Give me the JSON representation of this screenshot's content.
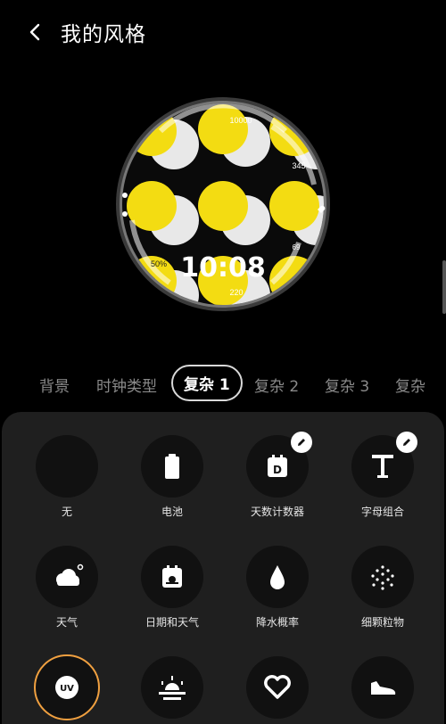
{
  "header": {
    "title": "我的风格",
    "back_icon": "back-arrow-icon"
  },
  "watch": {
    "time": "10:08",
    "steps_top": "10000",
    "steps_right": "345",
    "battery": "50%",
    "bottom_value": "220",
    "right_value": "69"
  },
  "tabs": [
    {
      "label": "背景"
    },
    {
      "label": "时钟类型"
    },
    {
      "label": "复杂 1"
    },
    {
      "label": "复杂 2"
    },
    {
      "label": "复杂 3"
    },
    {
      "label": "复杂"
    }
  ],
  "active_tab": "复杂 1",
  "grid": [
    {
      "label": "无",
      "icon": "empty-icon"
    },
    {
      "label": "电池",
      "icon": "battery-icon"
    },
    {
      "label": "天数计数器",
      "icon": "day-counter-icon",
      "editable": true
    },
    {
      "label": "字母组合",
      "icon": "monogram-icon",
      "editable": true
    },
    {
      "label": "天气",
      "icon": "weather-icon"
    },
    {
      "label": "日期和天气",
      "icon": "date-weather-icon"
    },
    {
      "label": "降水概率",
      "icon": "raindrop-icon"
    },
    {
      "label": "细颗粒物",
      "icon": "fine-dust-icon"
    },
    {
      "label": "",
      "icon": "uv-icon",
      "selected": true
    },
    {
      "label": "",
      "icon": "sunrise-icon"
    },
    {
      "label": "",
      "icon": "heart-icon"
    },
    {
      "label": "",
      "icon": "shoe-icon"
    }
  ],
  "colors": {
    "accent": "#f0a040",
    "watch_yellow": "#f3dc12",
    "panel": "#1f1f1f"
  }
}
